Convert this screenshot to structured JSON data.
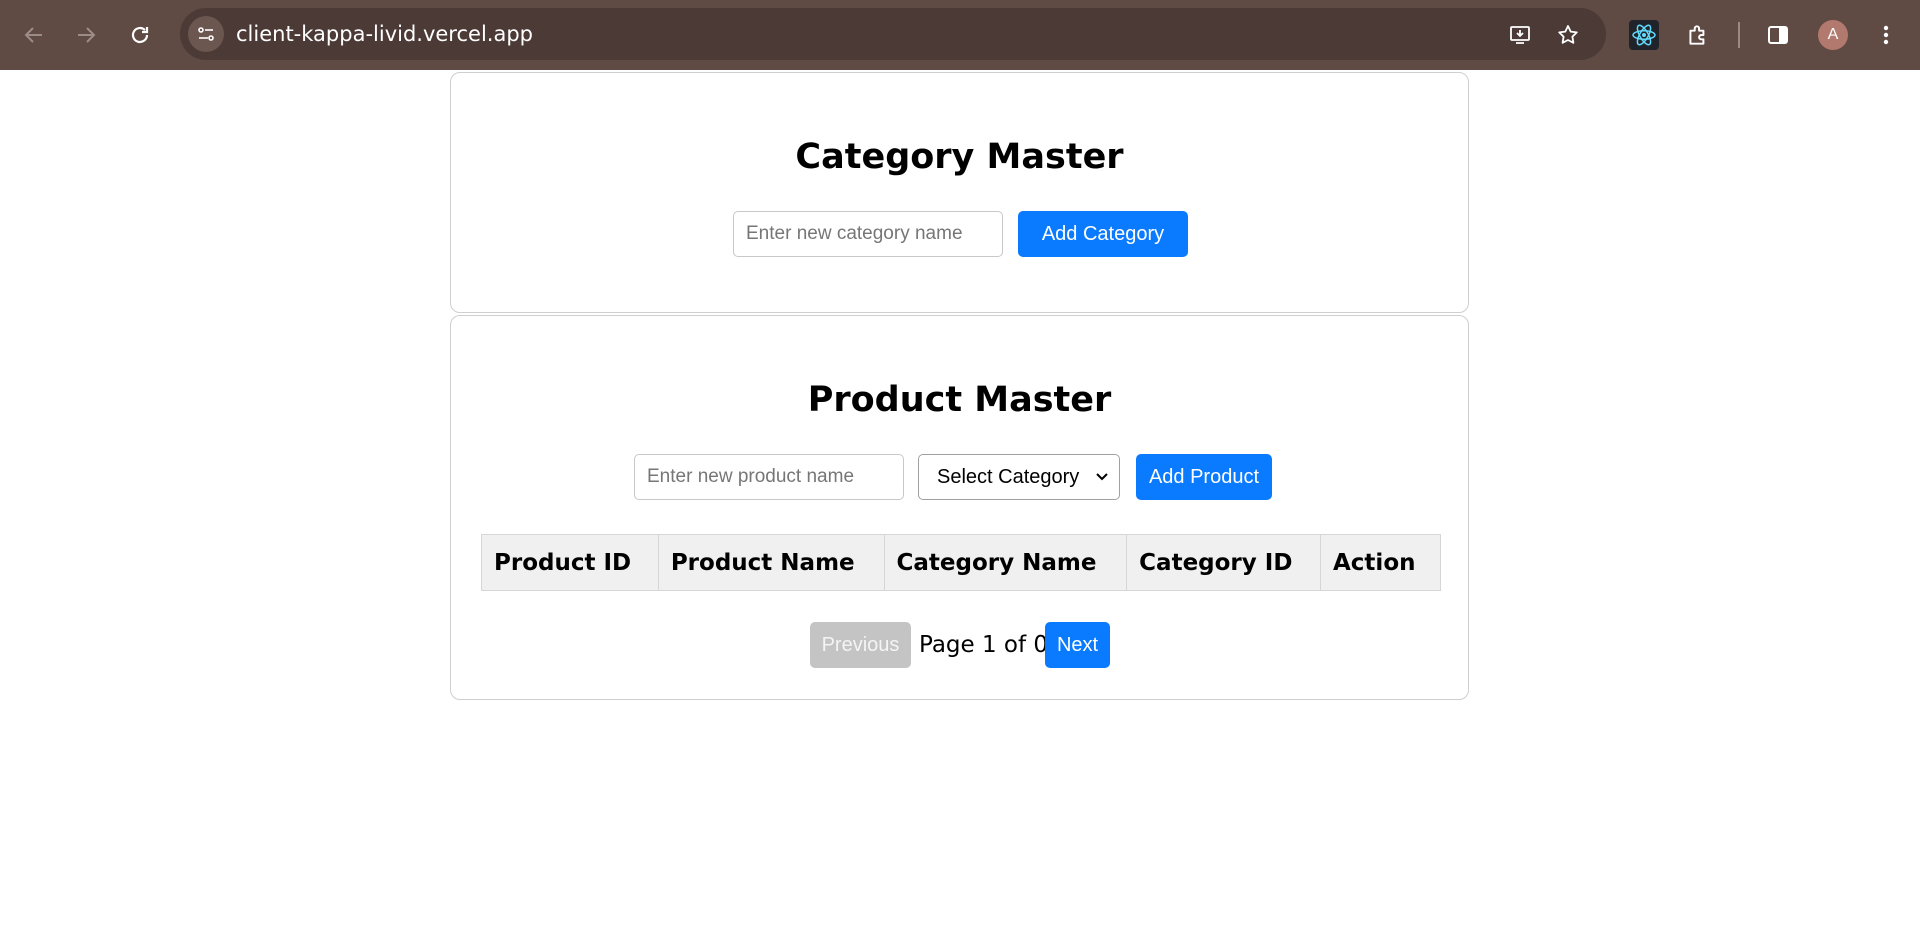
{
  "browser": {
    "url": "client-kappa-livid.vercel.app",
    "avatar_letter": "A"
  },
  "category_master": {
    "title": "Category Master",
    "input_placeholder": "Enter new category name",
    "add_button": "Add Category"
  },
  "product_master": {
    "title": "Product Master",
    "input_placeholder": "Enter new product name",
    "category_select": "Select Category",
    "add_button": "Add Product",
    "table": {
      "columns": [
        "Product ID",
        "Product Name",
        "Category Name",
        "Category ID",
        "Action"
      ],
      "rows": []
    },
    "pagination": {
      "previous": "Previous",
      "page_text": "Page 1 of 0",
      "next": "Next"
    }
  },
  "colors": {
    "accent": "#0a7bff",
    "disabled": "#c4c4c4",
    "chrome": "#5f4a44"
  }
}
